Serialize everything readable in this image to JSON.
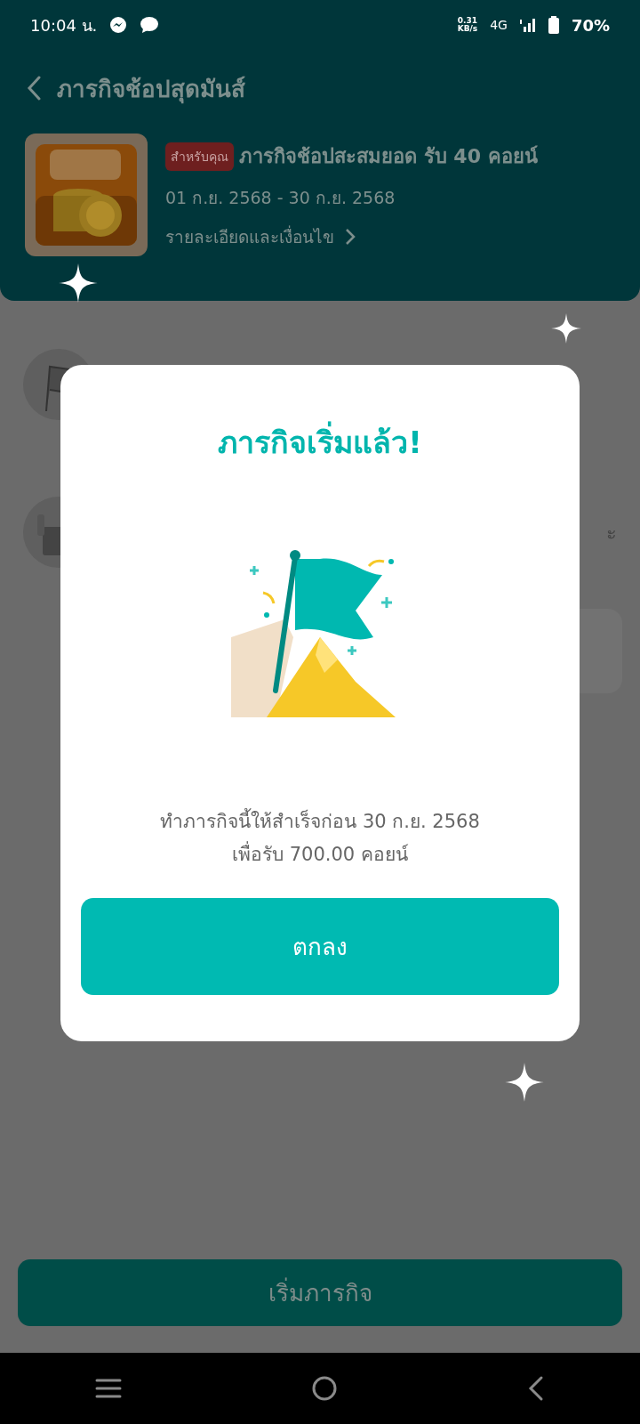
{
  "status_bar": {
    "time": "10:04 น.",
    "net_speed_value": "0.31",
    "net_speed_unit": "KB/s",
    "network": "4G",
    "battery": "70%"
  },
  "header": {
    "title": "ภารกิจช้อปสุดมันส์"
  },
  "mission": {
    "badge": "สำหรับคุณ",
    "title": "ภารกิจช้อปสะสมยอด รับ 40 คอยน์",
    "dates": "01 ก.ย. 2568 - 30 ก.ย. 2568",
    "details_link": "รายละเอียดและเงื่อนไข"
  },
  "steps": [
    {
      "kind": "flag"
    },
    {
      "kind": "bag",
      "text": "ะ"
    }
  ],
  "dialog": {
    "title": "ภารกิจเริ่มแล้ว!",
    "message_lines": [
      "ทำภารกิจนี้ให้สำเร็จก่อน 30 ก.ย. 2568",
      "เพื่อรับ 700.00 คอยน์"
    ],
    "button": "ตกลง"
  },
  "primary_button": {
    "label": "เริ่มภารกิจ"
  }
}
